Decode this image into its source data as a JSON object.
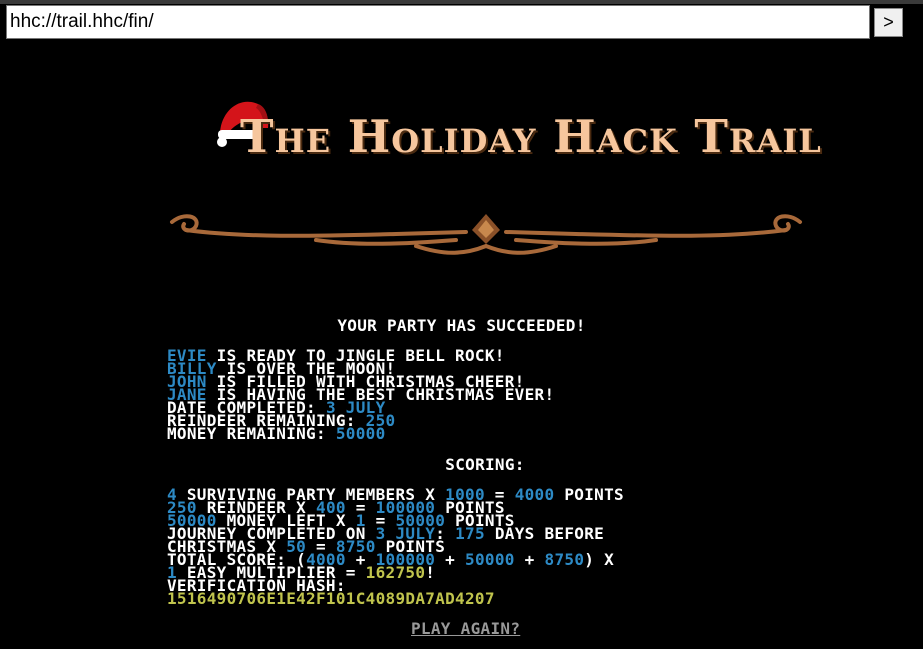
{
  "browser": {
    "url": "hhc://trail.hhc/fin/",
    "go_label": ">"
  },
  "header": {
    "title": "The Holiday Hack Trail"
  },
  "results": {
    "headline": "YOUR PARTY HAS SUCCEEDED!",
    "party": [
      {
        "name": "EVIE",
        "status": "IS READY TO JINGLE BELL ROCK!"
      },
      {
        "name": "BILLY",
        "status": "IS OVER THE MOON!"
      },
      {
        "name": "JOHN",
        "status": "IS FILLED WITH CHRISTMAS CHEER!"
      },
      {
        "name": "JANE",
        "status": "IS HAVING THE BEST CHRISTMAS EVER!"
      }
    ],
    "date_label": "DATE COMPLETED:",
    "date_value": "3 JULY",
    "reindeer_label": "REINDEER REMAINING:",
    "reindeer_value": "250",
    "money_label": "MONEY REMAINING:",
    "money_value": "50000"
  },
  "scoring": {
    "title": "SCORING:",
    "members_count": "4",
    "members_text": "SURVIVING PARTY MEMBERS X",
    "members_multiplier": "1000",
    "members_points": "4000",
    "points_word": "POINTS",
    "reindeer_count": "250",
    "reindeer_text": "REINDEER X",
    "reindeer_multiplier": "400",
    "reindeer_points": "100000",
    "money_count": "50000",
    "money_text": "MONEY LEFT X",
    "money_multiplier": "1",
    "money_points": "50000",
    "journey_text": "JOURNEY COMPLETED ON",
    "journey_date": "3 JULY",
    "days_value": "175",
    "days_text": "DAYS BEFORE",
    "christmas_text": "CHRISTMAS X",
    "christmas_multiplier": "50",
    "christmas_points": "8750",
    "total_label": "TOTAL SCORE: (",
    "total_terms": [
      "4000",
      "100000",
      "50000",
      "8750"
    ],
    "easy_multiplier": "1",
    "easy_text": "EASY MULTIPLIER =",
    "total_score": "162750",
    "hash_label": "VERIFICATION HASH:",
    "hash_value": "1516490706E1E42F101C4089DA7AD4207"
  },
  "actions": {
    "play_again": "PLAY AGAIN?"
  },
  "colors": {
    "highlight": "#2d8ac5",
    "total": "#c0c44d",
    "title": "#f6c69d",
    "ornament": "#a8693a"
  }
}
